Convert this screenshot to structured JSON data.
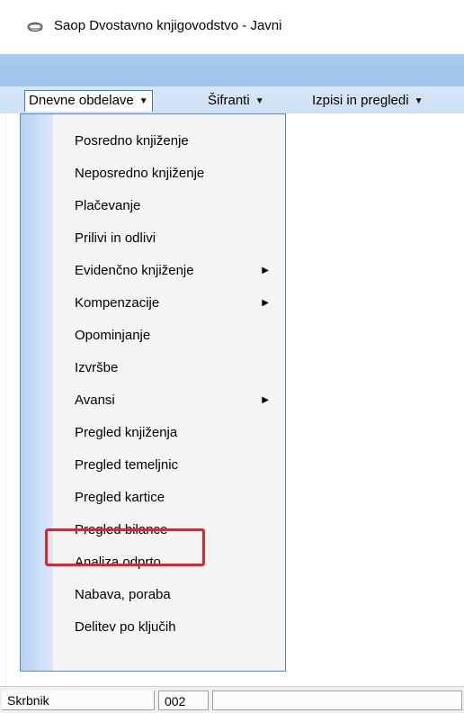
{
  "window": {
    "title": "Saop Dvostavno knjigovodstvo - Javni",
    "icon": "app-icon"
  },
  "menubar": {
    "items": [
      {
        "label": "Dnevne obdelave",
        "accel": "D"
      },
      {
        "label": "Šifranti",
        "accel": "f"
      },
      {
        "label": "Izpisi in pregledi",
        "accel": "I"
      }
    ]
  },
  "dropdown": {
    "items": [
      {
        "label": "Posredno knjiženje",
        "submenu": false
      },
      {
        "label": "Neposredno knjiženje",
        "submenu": false
      },
      {
        "label": "Plačevanje",
        "submenu": false
      },
      {
        "label": "Prilivi in odlivi",
        "submenu": false
      },
      {
        "label": "Evidenčno knjiženje",
        "submenu": true
      },
      {
        "label": "Kompenzacije",
        "submenu": true
      },
      {
        "label": "Opominjanje",
        "submenu": false
      },
      {
        "label": "Izvršbe",
        "submenu": false
      },
      {
        "label": "Avansi",
        "submenu": true
      },
      {
        "label": "Pregled knjiženja",
        "submenu": false
      },
      {
        "label": "Pregled temeljnic",
        "submenu": false
      },
      {
        "label": "Pregled kartice",
        "submenu": false
      },
      {
        "label": "Pregled bilance",
        "submenu": false,
        "highlighted": true
      },
      {
        "label": "Analiza odprto",
        "submenu": false
      },
      {
        "label": "Nabava, poraba",
        "submenu": false
      },
      {
        "label": "Delitev po ključih",
        "submenu": false
      }
    ],
    "highlight_color": "#e0252b"
  },
  "statusbar": {
    "user": "Skrbnik",
    "code": "002",
    "extra": ""
  },
  "colors": {
    "menubar_band": "#a9c9ee",
    "menu_border": "#3c7ad3"
  }
}
